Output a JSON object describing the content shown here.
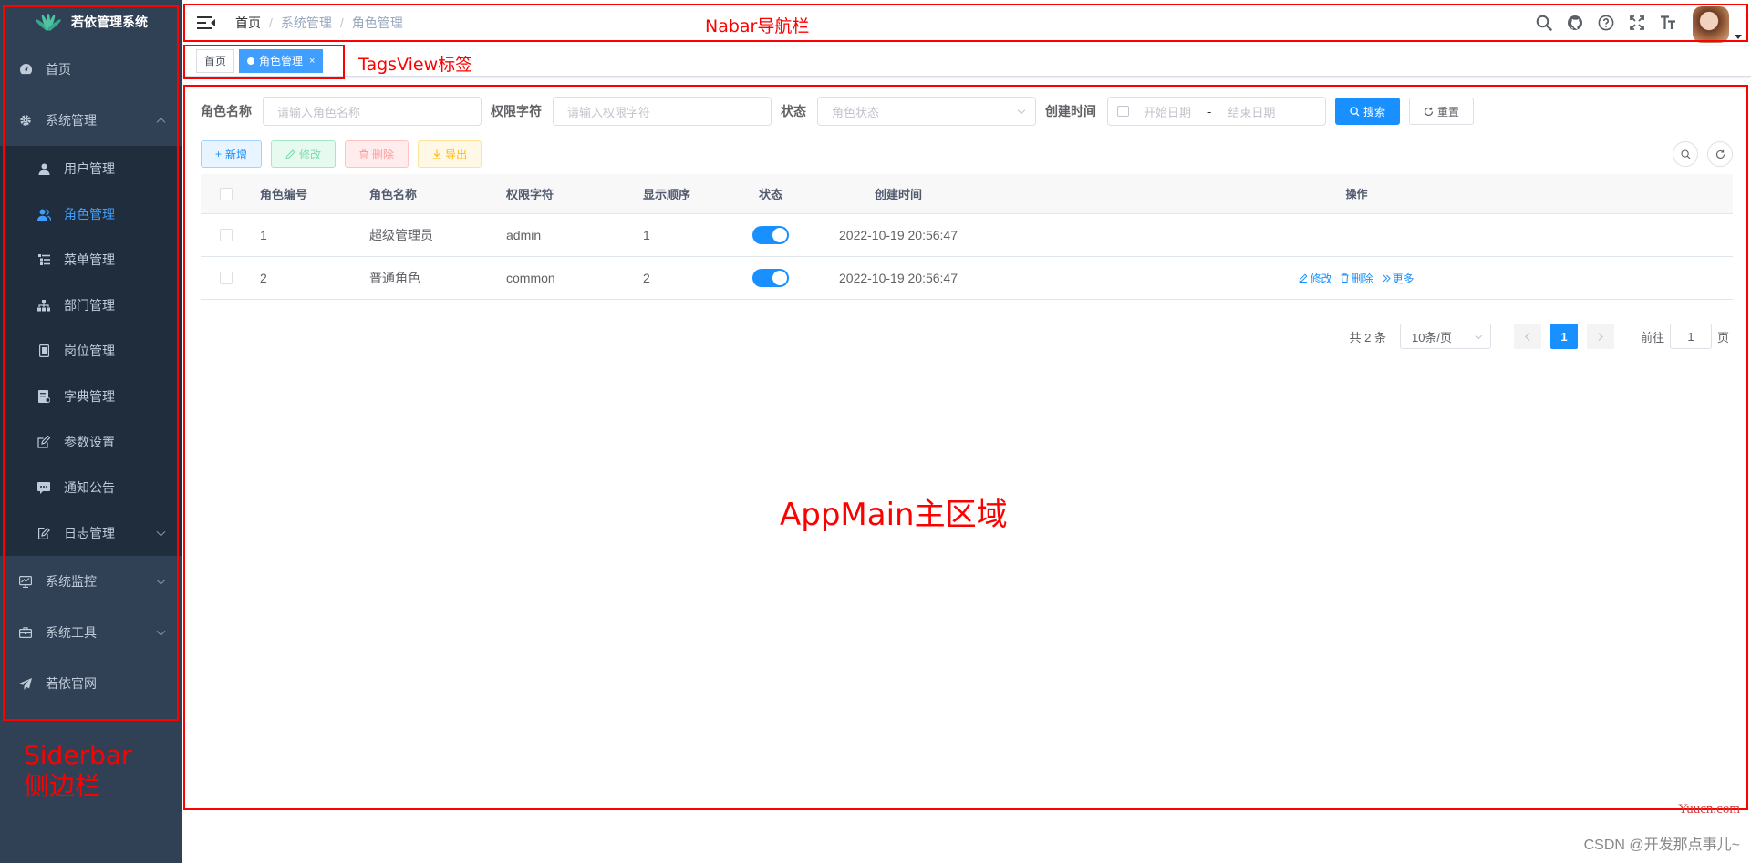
{
  "sidebar": {
    "logo_title": "若依管理系统",
    "items": [
      {
        "label": "首页",
        "icon": "dashboard-icon"
      },
      {
        "label": "系统管理",
        "icon": "gear-icon",
        "expanded": true,
        "children": [
          {
            "label": "用户管理",
            "icon": "user-icon"
          },
          {
            "label": "角色管理",
            "icon": "peoples-icon",
            "active": true
          },
          {
            "label": "菜单管理",
            "icon": "tree-table-icon"
          },
          {
            "label": "部门管理",
            "icon": "tree-icon"
          },
          {
            "label": "岗位管理",
            "icon": "post-icon"
          },
          {
            "label": "字典管理",
            "icon": "dict-icon"
          },
          {
            "label": "参数设置",
            "icon": "edit-icon"
          },
          {
            "label": "通知公告",
            "icon": "message-icon"
          },
          {
            "label": "日志管理",
            "icon": "log-icon"
          }
        ]
      },
      {
        "label": "系统监控",
        "icon": "monitor-icon"
      },
      {
        "label": "系统工具",
        "icon": "tool-icon"
      },
      {
        "label": "若依官网",
        "icon": "guide-icon"
      }
    ]
  },
  "navbar": {
    "breadcrumb": [
      "首页",
      "系统管理",
      "角色管理"
    ]
  },
  "tagsview": {
    "tags": [
      {
        "label": "首页",
        "active": false
      },
      {
        "label": "角色管理",
        "active": true,
        "close": "×"
      }
    ]
  },
  "search": {
    "role_name_label": "角色名称",
    "role_name_placeholder": "请输入角色名称",
    "role_key_label": "权限字符",
    "role_key_placeholder": "请输入权限字符",
    "status_label": "状态",
    "status_placeholder": "角色状态",
    "created_label": "创建时间",
    "start_placeholder": "开始日期",
    "range_sep": "-",
    "end_placeholder": "结束日期",
    "search_button": "搜索",
    "reset_button": "重置"
  },
  "toolbar": {
    "add": "新增",
    "edit": "修改",
    "delete": "删除",
    "export": "导出"
  },
  "table": {
    "headers": {
      "id": "角色编号",
      "name": "角色名称",
      "key": "权限字符",
      "sort": "显示顺序",
      "status": "状态",
      "created": "创建时间",
      "ops": "操作"
    },
    "rows": [
      {
        "id": "1",
        "name": "超级管理员",
        "key": "admin",
        "sort": "1",
        "status_on": true,
        "created": "2022-10-19 20:56:47"
      },
      {
        "id": "2",
        "name": "普通角色",
        "key": "common",
        "sort": "2",
        "status_on": true,
        "created": "2022-10-19 20:56:47",
        "ops": {
          "edit": "修改",
          "delete": "删除",
          "more": "更多"
        }
      }
    ]
  },
  "pagination": {
    "total": "共 2 条",
    "page_size": "10条/页",
    "current": "1",
    "goto_label": "前往",
    "goto_value": "1",
    "page_suffix": "页"
  },
  "annotations": {
    "navbar": "Nabar导航栏",
    "tagsview": "TagsView标签",
    "appmain": "AppMain主区域",
    "sidebar_line1": "Siderbar",
    "sidebar_line2": "侧边栏",
    "color": "#ff0000"
  },
  "watermarks": {
    "yuucn": "Yuucn.com",
    "csdn": "CSDN @开发那点事儿~"
  },
  "colors": {
    "sidebar_bg": "#304156",
    "submenu_bg": "#1f2d3d",
    "primary": "#1890ff",
    "active_menu": "#409eff"
  }
}
